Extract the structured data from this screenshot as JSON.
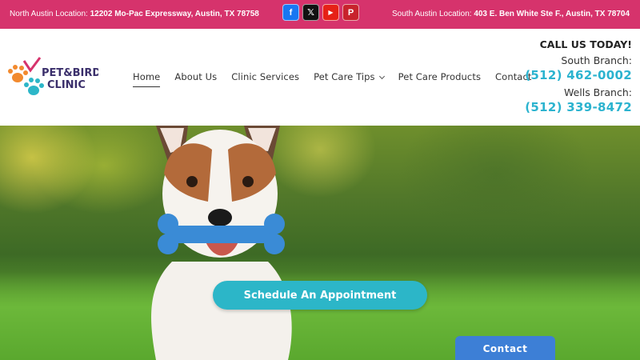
{
  "topbar": {
    "north_prefix": "North Austin Location: ",
    "north_address": "12202 Mo-Pac Expressway, Austin, TX 78758",
    "south_prefix": "South Austin Location: ",
    "south_address": "403 E. Ben White Ste F., Austin, TX 78704",
    "social": [
      {
        "name": "facebook-icon",
        "glyph": "f"
      },
      {
        "name": "x-icon",
        "glyph": "𝕏"
      },
      {
        "name": "youtube-icon",
        "glyph": "▶"
      },
      {
        "name": "pinterest-icon",
        "glyph": "P"
      }
    ],
    "color": "#d6336c"
  },
  "logo": {
    "text_line1": "PET&BIRD",
    "text_line2": "CLINIC"
  },
  "nav": {
    "items": [
      "Home",
      "About Us",
      "Clinic Services",
      "Pet Care Tips",
      "Pet Care Products",
      "Contact"
    ],
    "active": "Home"
  },
  "contact": {
    "call_today": "CALL US TODAY!",
    "south_label": "South Branch:",
    "south_phone": "(512) 462-0002",
    "wells_label": "Wells Branch:",
    "wells_phone": "(512) 339-8472",
    "accent": "#2bb3cf"
  },
  "hero": {
    "cta_label": "Schedule An Appointment",
    "cta_color": "#2cb6c8"
  },
  "floating": {
    "contact_label": "Contact",
    "color": "#3d7fd6"
  }
}
